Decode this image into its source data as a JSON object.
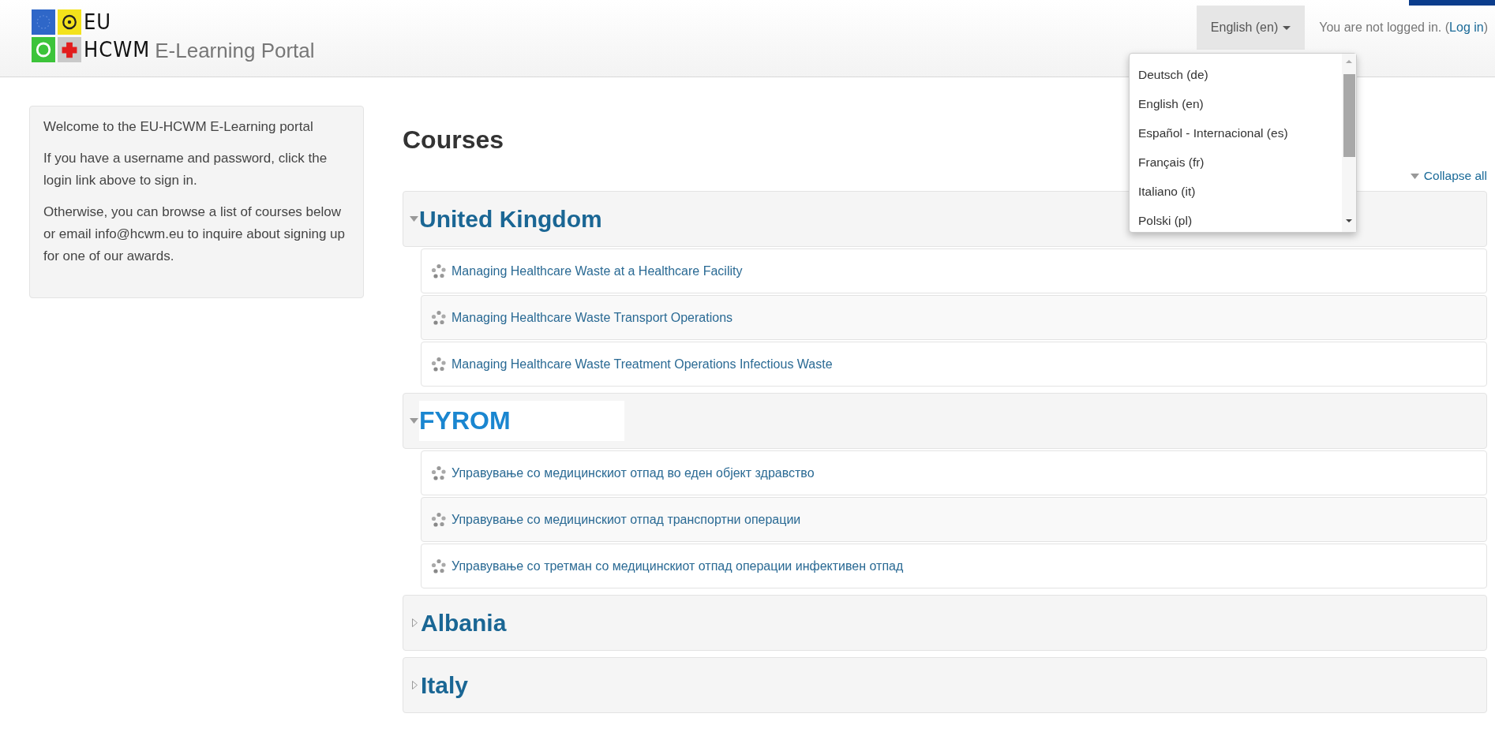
{
  "header": {
    "logo_top": "EU",
    "logo_bottom": "HCWM",
    "site_name": "E-Learning Portal",
    "language": "English (en)",
    "login_prefix": "You are not logged in. (",
    "login_link": "Log in",
    "login_suffix": ")"
  },
  "language_menu": {
    "open": true,
    "items": [
      "Deutsch (de)",
      "English (en)",
      "Español - Internacional (es)",
      "Français (fr)",
      "Italiano (it)",
      "Polski (pl)"
    ]
  },
  "sidebar": {
    "paragraphs": [
      "Welcome to the EU-HCWM E-Learning portal",
      "If you have a username and password, click the login link above to sign in.",
      "Otherwise, you can browse a list of courses below or email info@hcwm.eu to inquire about signing up for one of our awards."
    ]
  },
  "page_title": "Courses",
  "collapse_all": "Collapse all",
  "categories": [
    {
      "name": "United Kingdom",
      "expanded": true,
      "kind": "plain",
      "courses": [
        "Managing Healthcare Waste at a Healthcare Facility",
        "Managing Healthcare Waste Transport Operations",
        "Managing Healthcare Waste Treatment Operations Infectious Waste"
      ]
    },
    {
      "name": "FYROM",
      "expanded": true,
      "kind": "patched",
      "courses": [
        "Управување со медицинскиот отпад во еден објект здравство",
        "Управување со медицинскиот отпад транспортни операции",
        "Управување со третман со медицинскиот отпад операции инфективен отпад"
      ]
    },
    {
      "name": "Albania",
      "expanded": false,
      "kind": "plain"
    },
    {
      "name": "Italy",
      "expanded": false,
      "kind": "plain"
    }
  ]
}
